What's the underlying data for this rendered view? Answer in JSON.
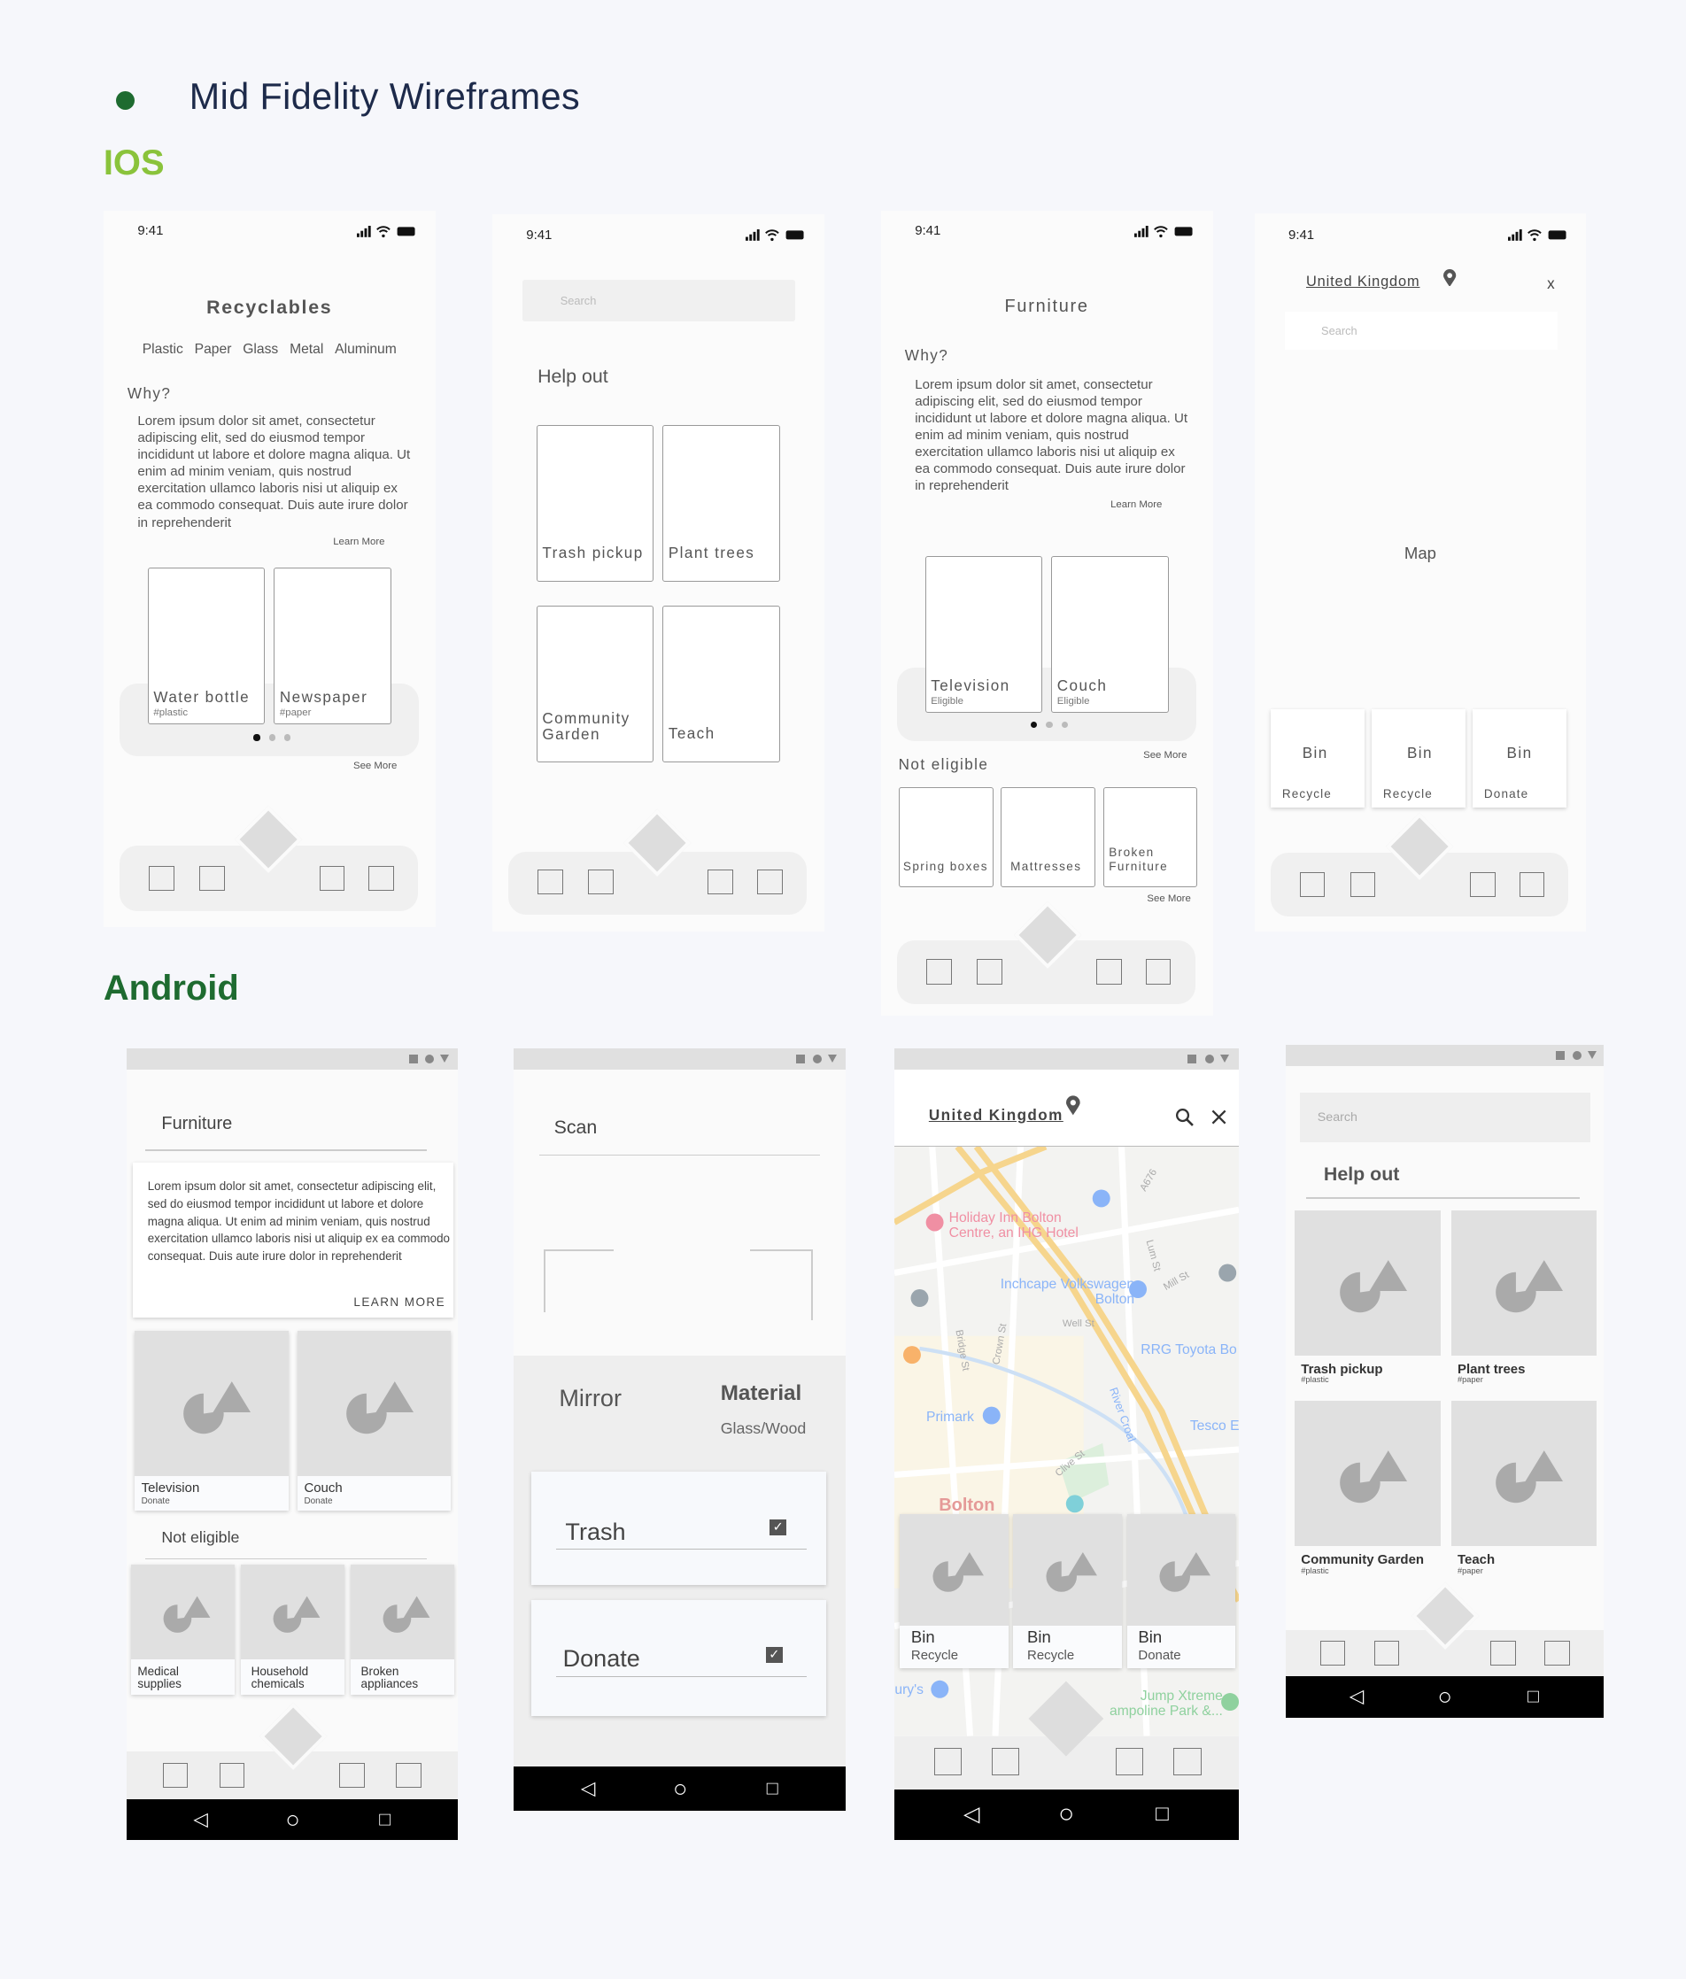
{
  "header": {
    "title": "Mid Fidelity Wireframes",
    "ios_label": "IOS",
    "android_label": "Android",
    "bullet_color": "#1e6b30",
    "ios_color": "#8ac33b",
    "android_color": "#1e6b30"
  },
  "status": {
    "time": "9:41"
  },
  "ios1": {
    "title": "Recyclables",
    "tabs": [
      "Plastic",
      "Paper",
      "Glass",
      "Metal",
      "Aluminum"
    ],
    "why": "Why?",
    "lorem": "Lorem ipsum dolor sit amet, consectetur adipiscing elit, sed do eiusmod tempor incididunt ut labore et dolore magna aliqua. Ut enim ad minim veniam, quis nostrud exercitation ullamco laboris nisi ut aliquip ex ea commodo consequat. Duis aute irure dolor in reprehenderit",
    "learn_more": "Learn More",
    "cards": [
      {
        "label": "Water bottle",
        "tag": "#plastic"
      },
      {
        "label": "Newspaper",
        "tag": "#paper"
      }
    ],
    "see_more": "See More"
  },
  "ios2": {
    "search_placeholder": "Search",
    "heading": "Help out",
    "cards": [
      "Trash pickup",
      "Plant trees",
      "Community Garden",
      "Teach"
    ]
  },
  "ios3": {
    "title": "Furniture",
    "why": "Why?",
    "lorem": "Lorem ipsum dolor sit amet, consectetur adipiscing elit, sed do eiusmod tempor incididunt ut labore et dolore magna aliqua. Ut enim ad minim veniam, quis nostrud exercitation ullamco laboris nisi ut aliquip ex ea commodo consequat. Duis aute irure dolor in reprehenderit",
    "learn_more": "Learn More",
    "cards": [
      {
        "label": "Television",
        "tag": "Eligible"
      },
      {
        "label": "Couch",
        "tag": "Eligible"
      }
    ],
    "see_more": "See More",
    "not_eligible": "Not eligible",
    "small_cards": [
      "Spring boxes",
      "Mattresses",
      "Broken Furniture"
    ],
    "see_more2": "See More"
  },
  "ios4": {
    "location": "United Kingdom",
    "close": "x",
    "search_placeholder": "Search",
    "map": "Map",
    "bins": [
      {
        "label": "Bin",
        "sub": "Recycle"
      },
      {
        "label": "Bin",
        "sub": "Recycle"
      },
      {
        "label": "Bin",
        "sub": "Donate"
      }
    ]
  },
  "and1": {
    "title": "Furniture",
    "lorem": "Lorem ipsum dolor sit amet, consectetur adipiscing elit, sed do eiusmod tempor incididunt ut labore et dolore magna aliqua. Ut enim ad minim veniam, quis nostrud exercitation ullamco laboris nisi ut aliquip ex ea commodo consequat. Duis aute irure dolor in reprehenderit",
    "learn_more": "LEARN MORE",
    "cards": [
      {
        "label": "Television",
        "tag": "Donate"
      },
      {
        "label": "Couch",
        "tag": "Donate"
      }
    ],
    "not_eligible": "Not eligible",
    "small_cards": [
      "Medical supplies",
      "Household chemicals",
      "Broken appliances"
    ]
  },
  "and2": {
    "title": "Scan",
    "mirror": "Mirror",
    "material": "Material",
    "material_value": "Glass/Wood",
    "options": [
      {
        "label": "Trash",
        "checked": true
      },
      {
        "label": "Donate",
        "checked": true
      }
    ]
  },
  "and3": {
    "location": "United Kingdom",
    "map_labels": {
      "hotel": "Holiday Inn Bolton Centre, an IHG Hotel",
      "inchcape": "Inchcape Volkswagen Bolton",
      "rrg": "RRG Toyota Bo",
      "primark": "Primark",
      "tesco": "Tesco E",
      "bolton": "Bolton",
      "jump": "Jump Xtreme ampoline Park &...",
      "burys": "ury's",
      "a676": "A676",
      "well": "Well St",
      "river": "River Croal",
      "bridge": "Bridge St",
      "crown": "Crown St",
      "clive": "Clive St",
      "lum": "Lum St",
      "mill": "Mill St"
    },
    "bins": [
      {
        "label": "Bin",
        "sub": "Recycle"
      },
      {
        "label": "Bin",
        "sub": "Recycle"
      },
      {
        "label": "Bin",
        "sub": "Donate"
      }
    ]
  },
  "and4": {
    "search_placeholder": "Search",
    "heading": "Help out",
    "cards": [
      {
        "label": "Trash pickup",
        "tag": "#plastic"
      },
      {
        "label": "Plant trees",
        "tag": "#paper"
      },
      {
        "label": "Community Garden",
        "tag": "#plastic"
      },
      {
        "label": "Teach",
        "tag": "#paper"
      }
    ]
  },
  "nav": {
    "back": "◁",
    "home": "○",
    "recent": "□"
  }
}
